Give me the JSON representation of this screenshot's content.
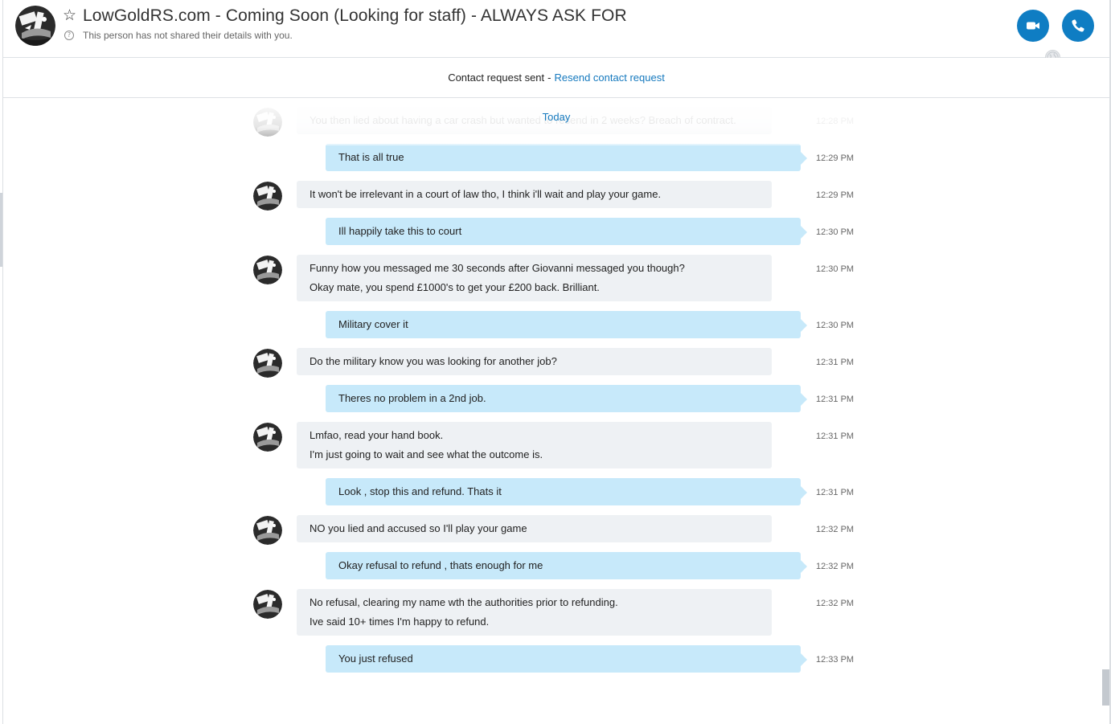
{
  "header": {
    "contact_name": "LowGoldRS.com - Coming Soon (Looking for staff) - ALWAYS ASK FOR",
    "subtitle": "This person has not shared their details with you.",
    "star_icon": "☆",
    "info_icon": "?",
    "video_call_icon": "video-camera-icon",
    "audio_call_icon": "phone-icon"
  },
  "request_bar": {
    "status": "Contact request sent",
    "separator": "-",
    "link": "Resend contact request"
  },
  "chat": {
    "date_separator": "Today",
    "messages": [
      {
        "dir": "in",
        "lines": [
          "You then lied about having a car crash but wanted to resend in 2 weeks? Breach of contract."
        ],
        "time": "12:28 PM"
      },
      {
        "dir": "out",
        "lines": [
          "That is all true"
        ],
        "time": "12:29 PM"
      },
      {
        "dir": "in",
        "lines": [
          "It won't be irrelevant in a court of law tho, I think i'll wait and play your game."
        ],
        "time": "12:29 PM"
      },
      {
        "dir": "out",
        "lines": [
          "Ill happily take this to court"
        ],
        "time": "12:30 PM"
      },
      {
        "dir": "in",
        "lines": [
          "Funny how you messaged me 30 seconds after Giovanni messaged you though?",
          "Okay mate, you spend £1000's to get your £200 back. Brilliant."
        ],
        "time": "12:30 PM"
      },
      {
        "dir": "out",
        "lines": [
          "Military cover it"
        ],
        "time": "12:30 PM"
      },
      {
        "dir": "in",
        "lines": [
          "Do the military know you was looking for another job?"
        ],
        "time": "12:31 PM"
      },
      {
        "dir": "out",
        "lines": [
          "Theres no problem in a 2nd job."
        ],
        "time": "12:31 PM"
      },
      {
        "dir": "in",
        "lines": [
          "Lmfao, read your hand book.",
          "I'm just going to wait and see what the outcome is."
        ],
        "time": "12:31 PM"
      },
      {
        "dir": "out",
        "lines": [
          "Look , stop this and refund. Thats it"
        ],
        "time": "12:31 PM"
      },
      {
        "dir": "in",
        "lines": [
          "NO you lied and accused so I'll play your game"
        ],
        "time": "12:32 PM"
      },
      {
        "dir": "out",
        "lines": [
          "Okay refusal to refund , thats enough for me"
        ],
        "time": "12:32 PM"
      },
      {
        "dir": "in",
        "lines": [
          "No refusal, clearing my name wth the authorities prior to refunding.",
          "Ive said 10+ times I'm happy to refund."
        ],
        "time": "12:32 PM"
      },
      {
        "dir": "out",
        "lines": [
          "You just refused"
        ],
        "time": "12:33 PM"
      }
    ]
  },
  "colors": {
    "accent": "#0f7dc3",
    "link": "#1579be",
    "incoming_bubble": "#eef1f4",
    "outgoing_bubble": "#c7e9fa"
  }
}
